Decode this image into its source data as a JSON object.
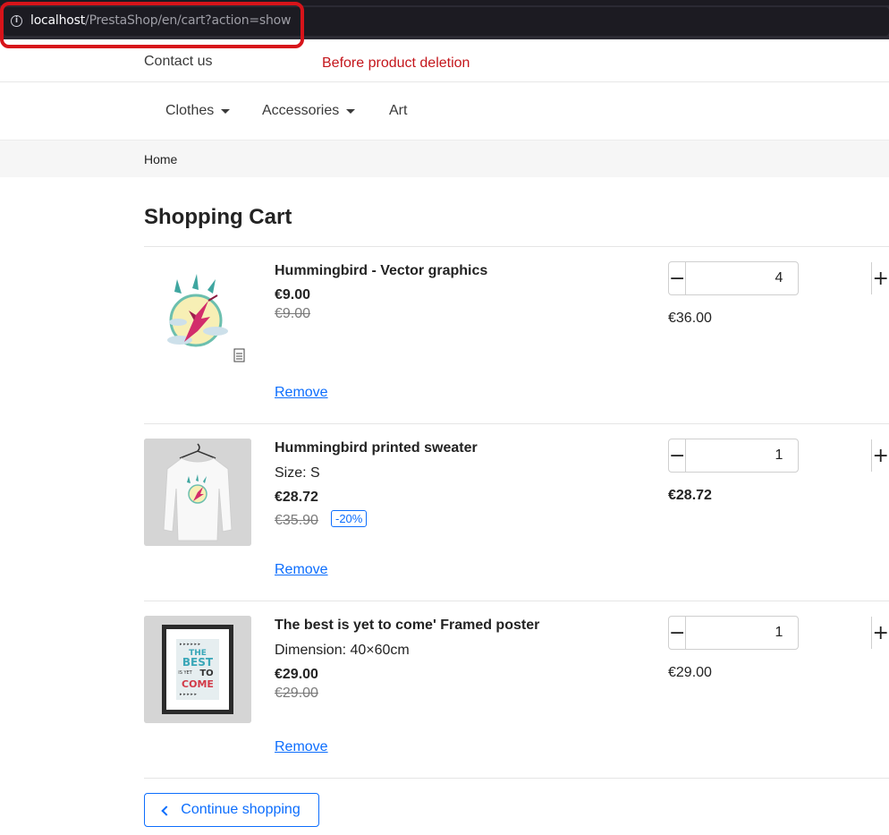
{
  "browser": {
    "url_host": "localhost",
    "url_path": "/PrestaShop/en/cart?action=show"
  },
  "annotation": "Before product deletion",
  "header": {
    "contact": "Contact us",
    "menu": [
      {
        "label": "Clothes",
        "has_dropdown": true
      },
      {
        "label": "Accessories",
        "has_dropdown": true
      },
      {
        "label": "Art",
        "has_dropdown": false
      }
    ]
  },
  "breadcrumb": "Home",
  "page_title": "Shopping Cart",
  "items": [
    {
      "name": "Hummingbird - Vector graphics",
      "attribute": "",
      "price": "€9.00",
      "old_price": "€9.00",
      "discount": "",
      "quantity": "4",
      "total": "€36.00",
      "remove": "Remove"
    },
    {
      "name": "Hummingbird printed sweater",
      "attribute": "Size: S",
      "price": "€28.72",
      "old_price": "€35.90",
      "discount": "-20%",
      "quantity": "1",
      "total": "€28.72",
      "remove": "Remove"
    },
    {
      "name": "The best is yet to come' Framed poster",
      "attribute": "Dimension: 40×60cm",
      "price": "€29.00",
      "old_price": "€29.00",
      "discount": "",
      "quantity": "1",
      "total": "€29.00",
      "remove": "Remove"
    }
  ],
  "qty_minus": "−",
  "qty_plus": "+",
  "continue_shopping": "Continue shopping",
  "poster_text": {
    "line1": "THE",
    "line2": "BEST",
    "line3": "IS YET",
    "line4": "TO",
    "line5": "COME"
  },
  "colors": {
    "accent": "#0d6efd",
    "annotation": "#c4161c",
    "highlight": "#d7141a"
  }
}
